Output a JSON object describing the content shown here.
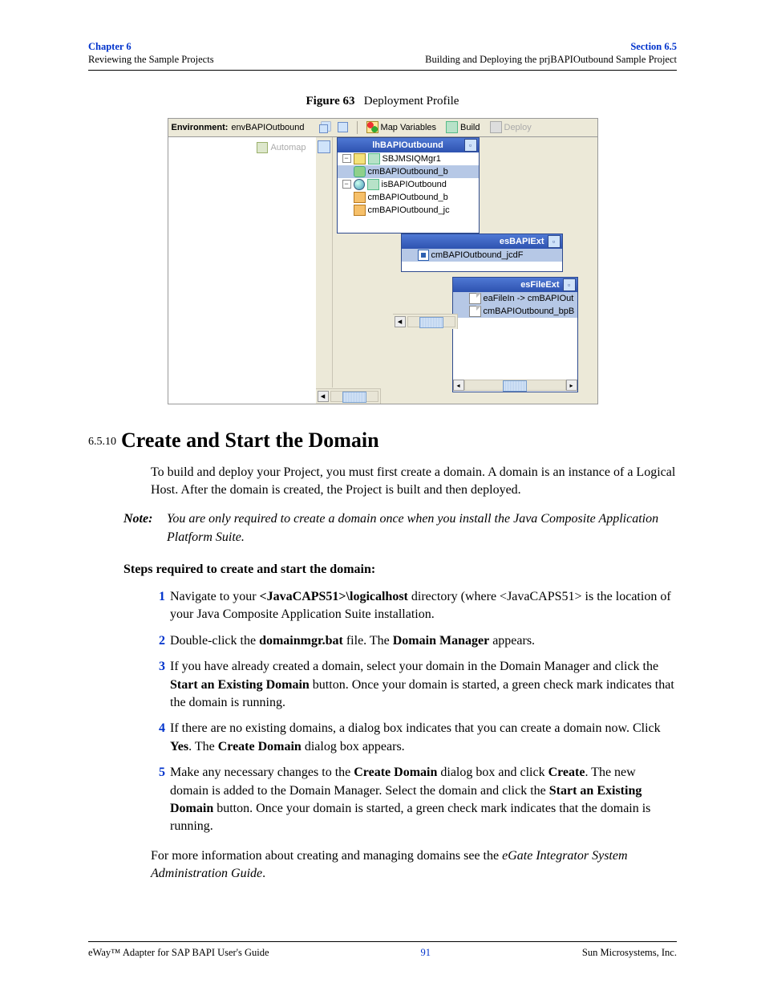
{
  "header": {
    "left_top": "Chapter 6",
    "left_sub": "Reviewing the Sample Projects",
    "right_top": "Section 6.5",
    "right_sub": "Building and Deploying the prjBAPIOutbound Sample Project"
  },
  "figure": {
    "caption_label": "Figure 63",
    "caption_text": "Deployment Profile",
    "env_label": "Environment:",
    "env_value": "envBAPIOutbound",
    "toolbar": {
      "map_variables": "Map Variables",
      "build": "Build",
      "deploy": "Deploy"
    },
    "automap": "Automap",
    "panel_lh": {
      "title": "lhBAPIOutbound",
      "rows": [
        "SBJMSIQMgr1",
        "cmBAPIOutbound_b",
        "isBAPIOutbound",
        "cmBAPIOutbound_b",
        "cmBAPIOutbound_jc"
      ]
    },
    "panel_es1": {
      "title": "esBAPIExt",
      "rows": [
        "cmBAPIOutbound_jcdF"
      ]
    },
    "panel_es2": {
      "title": "esFileExt",
      "rows": [
        "eaFileIn -> cmBAPIOut",
        "cmBAPIOutbound_bpB"
      ]
    }
  },
  "section": {
    "number": "6.5.10",
    "title": "Create and Start the Domain",
    "intro": "To build and deploy your Project, you must first create a domain. A domain is an instance of a Logical Host. After the domain is created, the Project is built and then deployed.",
    "note_label": "Note:",
    "note_text": "You are only required to create a domain once when you install the Java Composite Application Platform Suite.",
    "steps_lead": "Steps required to create and start the domain:",
    "steps": [
      {
        "n": "1",
        "pre": "Navigate to your ",
        "b1": "<JavaCAPS51>\\logicalhost",
        "post": " directory (where <JavaCAPS51> is the location of your Java Composite Application Suite installation."
      },
      {
        "n": "2",
        "pre": "Double-click the ",
        "b1": "domainmgr.bat",
        "mid": " file. The ",
        "b2": "Domain Manager",
        "post": " appears."
      },
      {
        "n": "3",
        "pre": "If you have already created a domain, select your domain in the Domain Manager and click the ",
        "b1": "Start an Existing Domain",
        "post": " button. Once your domain is started, a green check mark indicates that the domain is running."
      },
      {
        "n": "4",
        "pre": "If there are no existing domains, a dialog box indicates that you can create a domain now. Click ",
        "b1": "Yes",
        "mid": ". The ",
        "b2": "Create Domain",
        "post": " dialog box appears."
      },
      {
        "n": "5",
        "pre": "Make any necessary changes to the ",
        "b1": "Create Domain",
        "mid": " dialog box and click ",
        "b2": "Create",
        "mid2": ". The new domain is added to the Domain Manager. Select the domain and click the ",
        "b3": "Start an Existing Domain",
        "post": " button. Once your domain is started, a green check mark indicates that the domain is running."
      }
    ],
    "after_pre": "For more information about creating and managing domains see the ",
    "after_i": "eGate Integrator System Administration Guide",
    "after_post": "."
  },
  "footer": {
    "left": "eWay™ Adapter for SAP BAPI User's Guide",
    "page": "91",
    "right": "Sun Microsystems, Inc."
  }
}
